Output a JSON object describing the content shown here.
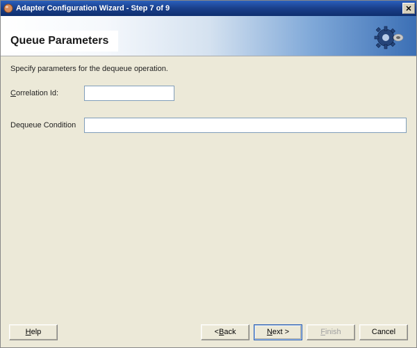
{
  "window": {
    "title": "Adapter Configuration Wizard - Step 7 of 9",
    "close_glyph": "✕"
  },
  "header": {
    "title": "Queue Parameters"
  },
  "content": {
    "instruction": "Specify parameters for the dequeue operation.",
    "correlation_label_pre": "C",
    "correlation_label_post": "orrelation Id:",
    "correlation_value": "",
    "dequeue_label": "Dequeue Condition",
    "dequeue_value": ""
  },
  "buttons": {
    "help_pre": "H",
    "help_post": "elp",
    "back_pre": "< ",
    "back_mn": "B",
    "back_post": "ack",
    "next_pre": "N",
    "next_post": "ext >",
    "finish_pre": "F",
    "finish_post": "inish",
    "cancel": "Cancel"
  }
}
